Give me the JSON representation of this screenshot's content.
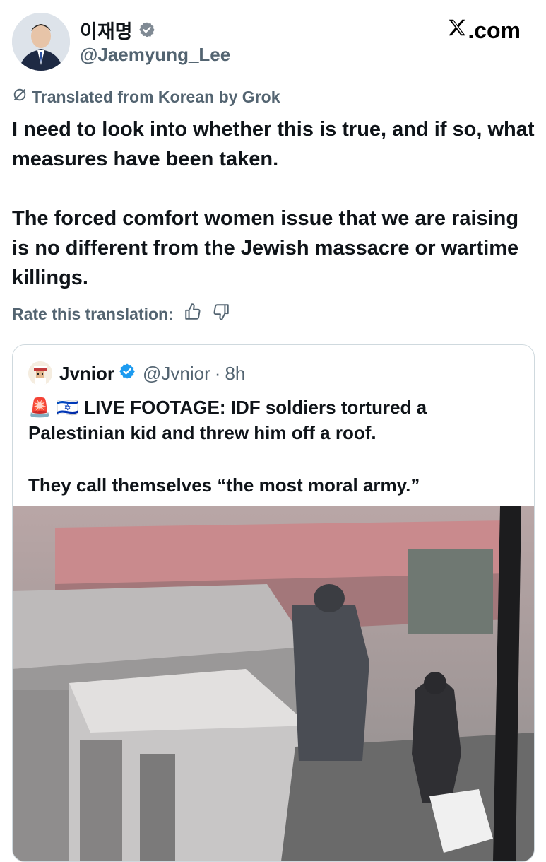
{
  "author": {
    "display_name": "이재명",
    "handle": "@Jaemyung_Lee",
    "verified_icon": "verified-badge-icon"
  },
  "site": {
    "label": ".com",
    "logo_icon": "x-logo-icon"
  },
  "translation": {
    "label": "Translated from Korean by Grok",
    "icon": "grok-icon"
  },
  "post": {
    "paragraphs": [
      "I need to look into whether this is true, and if so, what measures have been taken.",
      "The forced comfort women issue that we are raising is no different from the Jewish massacre or wartime killings."
    ]
  },
  "rate": {
    "label": "Rate this translation:",
    "icons": [
      "thumbs-up-icon",
      "thumbs-down-icon"
    ]
  },
  "quoted": {
    "display_name": "Jvnior",
    "handle": "@Jvnior",
    "separator": "·",
    "time": "8h",
    "line1_emoji": "🚨 🇮🇱",
    "line1": "LIVE FOOTAGE: IDF soldiers tortured a Palestinian kid and threw him off a roof.",
    "line2": "They call themselves “the most moral army.”",
    "media_description_icon": "video-thumbnail"
  },
  "colors": {
    "text": "#0f1419",
    "secondary": "#536471",
    "verified": "#1d9bf0",
    "border": "#cfd9de"
  }
}
